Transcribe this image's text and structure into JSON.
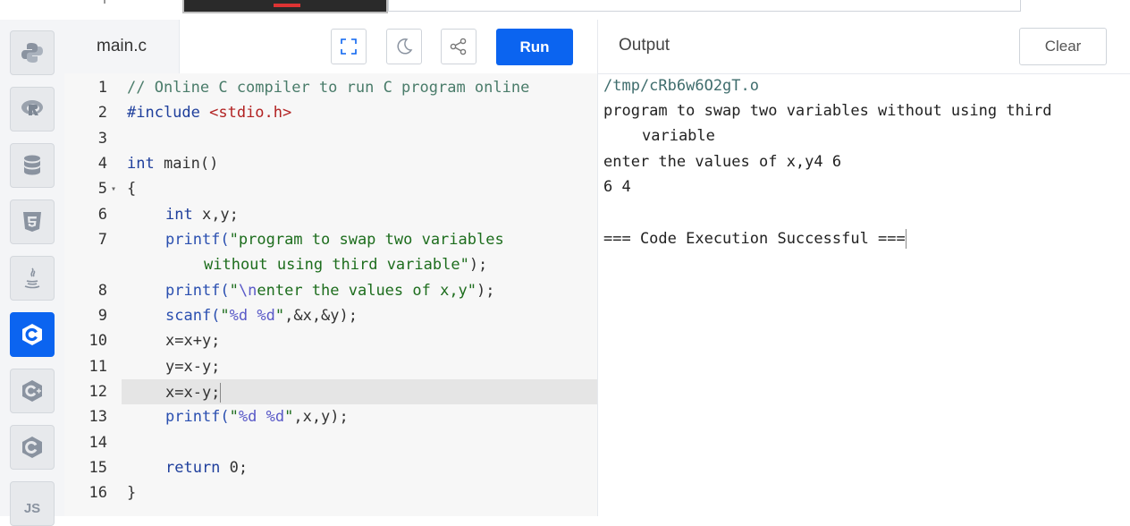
{
  "editor": {
    "tab_label": "main.c",
    "run_label": "Run",
    "lines": [
      {
        "num": "1"
      },
      {
        "num": "2"
      },
      {
        "num": "3"
      },
      {
        "num": "4"
      },
      {
        "num": "5"
      },
      {
        "num": "6"
      },
      {
        "num": "7"
      },
      {
        "num": "8"
      },
      {
        "num": "9"
      },
      {
        "num": "10"
      },
      {
        "num": "11"
      },
      {
        "num": "12"
      },
      {
        "num": "13"
      },
      {
        "num": "14"
      },
      {
        "num": "15"
      },
      {
        "num": "16"
      }
    ],
    "code": {
      "l1": "// Online C compiler to run C program online",
      "l2a": "#include ",
      "l2b": "<stdio.h>",
      "l4a": "int",
      "l4b": " main()",
      "l5": "{",
      "l6a": "int",
      "l6b": " x,y;",
      "l7a": "printf(",
      "l7b": "\"program to swap two variables",
      "l7c": "without using third variable\"",
      "l7d": ");",
      "l8a": "printf(",
      "l8b": "\"",
      "l8c": "\\n",
      "l8d": "enter the values of x,y\"",
      "l8e": ");",
      "l9a": "scanf(",
      "l9b": "\"",
      "l9c": "%d %d",
      "l9d": "\"",
      "l9e": ",&x,&y);",
      "l10": "x=x+y;",
      "l11": "y=x-y;",
      "l12": "x=x-y;",
      "l13a": "printf(",
      "l13b": "\"",
      "l13c": "%d %d",
      "l13d": "\"",
      "l13e": ",x,y);",
      "l15a": "return",
      "l15b": " 0;",
      "l16": "}"
    }
  },
  "output": {
    "title": "Output",
    "clear_label": "Clear",
    "lines": [
      "/tmp/cRb6w6O2gT.o",
      "program to swap two variables without using third",
      "variable",
      "enter the values of x,y4 6",
      "6 4",
      "=== Code Execution Successful ==="
    ]
  },
  "sidebar": {
    "items": [
      "python-icon",
      "r-icon",
      "database-icon",
      "html5-icon",
      "java-icon",
      "c-icon",
      "cpp-icon",
      "csharp-icon",
      "js-icon"
    ],
    "js_label": "JS"
  },
  "colors": {
    "accent": "#0b64f0"
  }
}
